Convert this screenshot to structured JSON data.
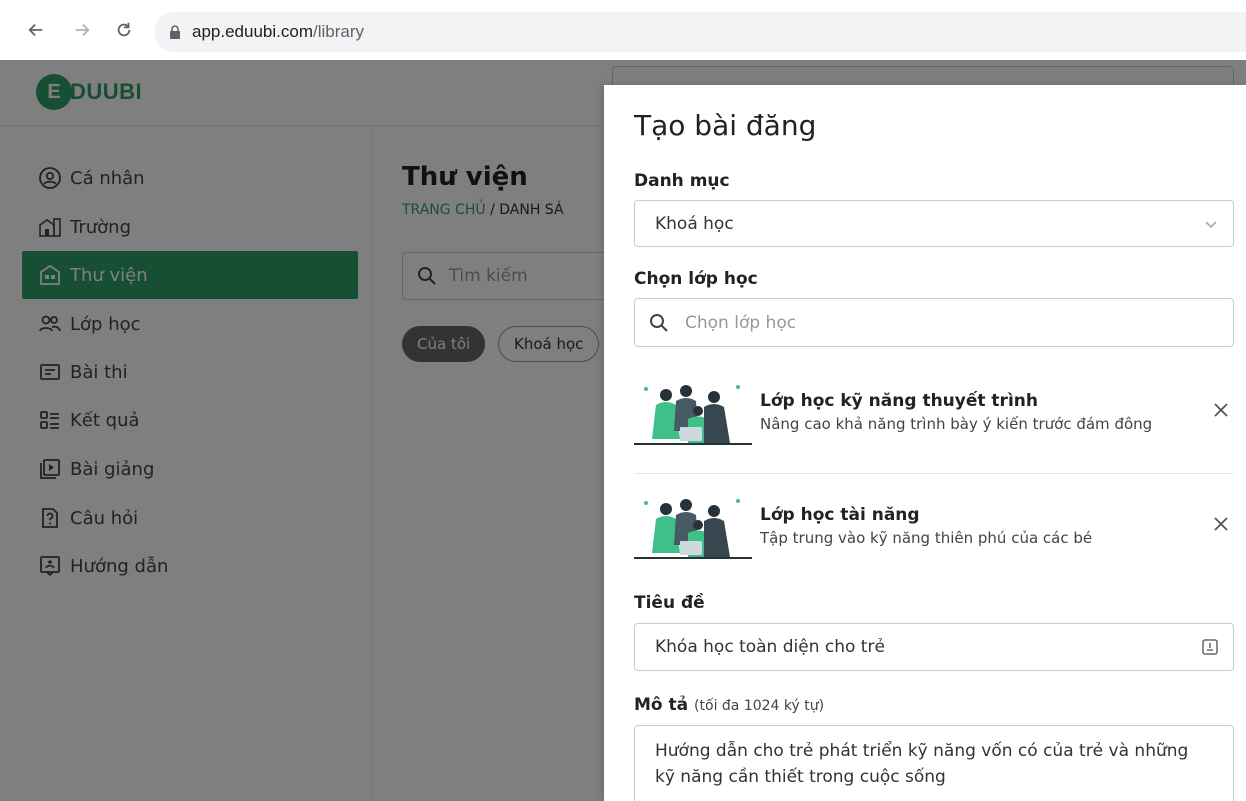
{
  "browser": {
    "url_host": "app.eduubi.com",
    "url_path": "/library"
  },
  "header": {
    "logo_letter": "E",
    "logo_text": "DUUBI"
  },
  "sidebar": {
    "items": [
      {
        "label": "Cá nhân",
        "icon": "user-circle-icon"
      },
      {
        "label": "Trường",
        "icon": "school-icon"
      },
      {
        "label": "Thư viện",
        "icon": "library-icon",
        "active": true
      },
      {
        "label": "Lớp học",
        "icon": "users-icon"
      },
      {
        "label": "Bài thi",
        "icon": "exam-icon"
      },
      {
        "label": "Kết quả",
        "icon": "results-icon"
      },
      {
        "label": "Bài giảng",
        "icon": "lecture-icon"
      },
      {
        "label": "Câu hỏi",
        "icon": "question-icon"
      },
      {
        "label": "Hướng dẫn",
        "icon": "guide-icon"
      }
    ]
  },
  "main": {
    "title": "Thư viện",
    "breadcrumb_home": "TRANG CHỦ",
    "breadcrumb_sep": "/",
    "breadcrumb_current": "DANH SÁ",
    "search_placeholder": "Tìm kiếm",
    "chips": [
      "Của tôi",
      "Khoá học"
    ]
  },
  "drawer": {
    "title": "Tạo bài đăng",
    "category_label": "Danh mục",
    "category_value": "Khoá học",
    "class_label": "Chọn lớp học",
    "class_placeholder": "Chọn lớp học",
    "classes": [
      {
        "title": "Lớp học kỹ năng thuyết trình",
        "desc": "Nâng cao khả năng trình bày ý kiến trước đám đông"
      },
      {
        "title": "Lớp học tài năng",
        "desc": "Tập trung vào kỹ năng thiên phú của các bé"
      }
    ],
    "title_label": "Tiêu đề",
    "title_value": "Khóa học toàn diện cho trẻ",
    "desc_label": "Mô tả",
    "desc_hint": "(tối đa 1024 ký tự)",
    "desc_value": "Hướng dẫn cho trẻ phát triển kỹ năng vốn có của trẻ và những kỹ năng cần thiết trong cuộc sống"
  },
  "colors": {
    "brand": "#2e9e6b"
  }
}
